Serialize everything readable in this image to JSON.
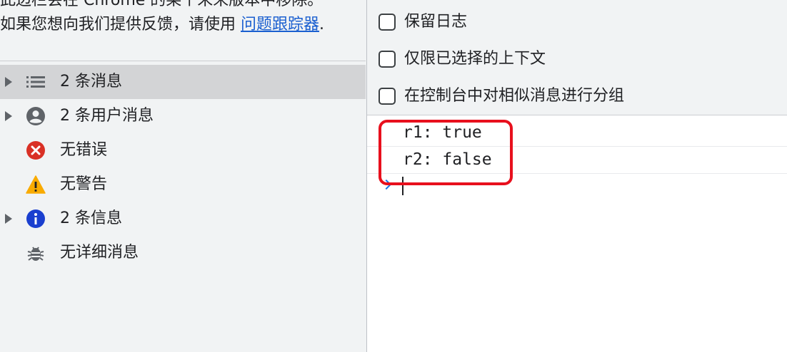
{
  "notice": {
    "line1": "此边栏会在 Chrome 的某个未来版本中移除。",
    "line2_prefix": "如果您想向我们提供反馈，请使用 ",
    "line2_link": "问题跟踪器",
    "line2_suffix": "."
  },
  "sidebar": {
    "items": [
      {
        "label": "2 条消息",
        "icon": "list-icon",
        "expandable": true,
        "selected": true
      },
      {
        "label": "2 条用户消息",
        "icon": "user-icon",
        "expandable": true,
        "selected": false
      },
      {
        "label": "无错误",
        "icon": "error-icon",
        "expandable": false,
        "selected": false
      },
      {
        "label": "无警告",
        "icon": "warning-icon",
        "expandable": false,
        "selected": false
      },
      {
        "label": "2 条信息",
        "icon": "info-icon",
        "expandable": true,
        "selected": false
      },
      {
        "label": "无详细消息",
        "icon": "bug-icon",
        "expandable": false,
        "selected": false
      }
    ]
  },
  "settings": {
    "preserve_log": {
      "label": "保留日志",
      "checked": false
    },
    "selected_context_only": {
      "label": "仅限已选择的上下文",
      "checked": false
    },
    "group_similar": {
      "label": "在控制台中对相似消息进行分组",
      "checked": false
    }
  },
  "console": {
    "lines": [
      "r1: true",
      "r2: false"
    ],
    "prompt_value": ""
  },
  "colors": {
    "error": "#d93025",
    "warning": "#f9ab00",
    "info": "#1a3fcf",
    "highlight": "#e8101d",
    "link": "#1a5fd0"
  }
}
